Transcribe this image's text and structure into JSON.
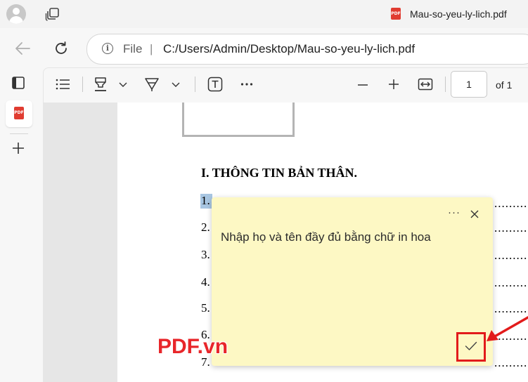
{
  "tab": {
    "title": "Mau-so-yeu-ly-lich.pdf",
    "badge": "PDF"
  },
  "address": {
    "scheme_label": "File",
    "separator": "|",
    "url": "C:/Users/Admin/Desktop/Mau-so-yeu-ly-lich.pdf"
  },
  "sidebar": {
    "tab_badge": "PDF"
  },
  "toolbar": {
    "page_number": "1",
    "page_of": "of 1"
  },
  "document": {
    "heading": "I. THÔNG TIN BẢN THÂN.",
    "items": [
      {
        "num": "1."
      },
      {
        "num": "2."
      },
      {
        "num": "3."
      },
      {
        "num": "4."
      },
      {
        "num": "5."
      },
      {
        "num": "6."
      },
      {
        "num": "7."
      }
    ],
    "dot_leader": "..........."
  },
  "note": {
    "text": "Nhập họ và tên đầy đủ bằng chữ in hoa"
  },
  "watermark": {
    "text": "PDF.vn"
  },
  "colors": {
    "highlight_box": "#e21b1b",
    "note_bg": "#fdf8c4",
    "selection": "#a8c6e2"
  }
}
